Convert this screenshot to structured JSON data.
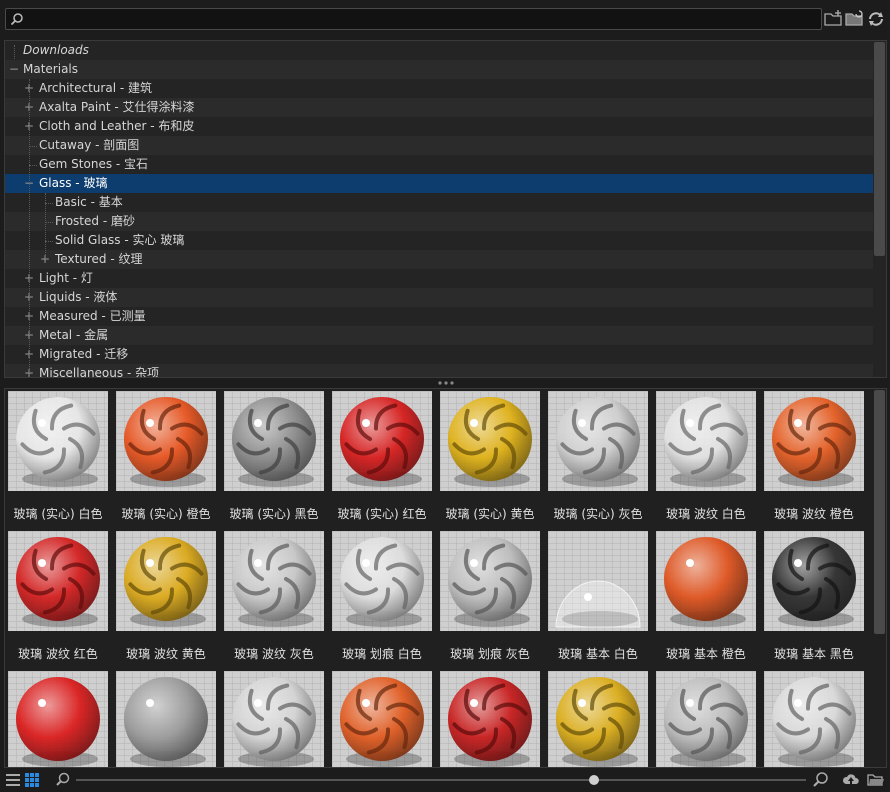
{
  "search": {
    "value": "",
    "placeholder": "",
    "icon": "search-icon"
  },
  "toolbar_top": {
    "icons": [
      "folder-add-icon",
      "folder-refresh-icon",
      "refresh-icon"
    ]
  },
  "tree": {
    "rows": [
      {
        "label": "Downloads",
        "level": 0,
        "expander": "",
        "italic": true
      },
      {
        "label": "Materials",
        "level": 0,
        "expander": "−"
      },
      {
        "label": "Architectural - 建筑",
        "level": 1,
        "expander": "+"
      },
      {
        "label": "Axalta Paint - 艾仕得涂料漆",
        "level": 1,
        "expander": "+"
      },
      {
        "label": "Cloth and Leather - 布和皮",
        "level": 1,
        "expander": "+"
      },
      {
        "label": "Cutaway - 剖面图",
        "level": 1,
        "expander": ""
      },
      {
        "label": "Gem Stones - 宝石",
        "level": 1,
        "expander": ""
      },
      {
        "label": "Glass - 玻璃",
        "level": 1,
        "expander": "−",
        "selected": true
      },
      {
        "label": "Basic - 基本",
        "level": 2,
        "expander": ""
      },
      {
        "label": "Frosted - 磨砂",
        "level": 2,
        "expander": ""
      },
      {
        "label": "Solid Glass - 实心 玻璃",
        "level": 2,
        "expander": ""
      },
      {
        "label": "Textured - 纹理",
        "level": 2,
        "expander": "+"
      },
      {
        "label": "Light - 灯",
        "level": 1,
        "expander": "+"
      },
      {
        "label": "Liquids - 液体",
        "level": 1,
        "expander": "+"
      },
      {
        "label": "Measured - 已测量",
        "level": 1,
        "expander": "+"
      },
      {
        "label": "Metal - 金属",
        "level": 1,
        "expander": "+"
      },
      {
        "label": "Migrated - 迁移",
        "level": 1,
        "expander": "+"
      },
      {
        "label": "Miscellaneous - 杂项",
        "level": 1,
        "expander": "+"
      }
    ]
  },
  "materials": [
    {
      "label": "玻璃 (实心) 白色",
      "color": "#e8e8e8",
      "style": "swirl"
    },
    {
      "label": "玻璃 (实心) 橙色",
      "color": "#e8501a",
      "style": "swirl"
    },
    {
      "label": "玻璃 (实心) 黑色",
      "color": "#8a8a8a",
      "style": "swirl"
    },
    {
      "label": "玻璃 (实心) 红色",
      "color": "#d81818",
      "style": "swirl"
    },
    {
      "label": "玻璃 (实心) 黄色",
      "color": "#e0b010",
      "style": "swirl"
    },
    {
      "label": "玻璃 (实心) 灰色",
      "color": "#cfcfcf",
      "style": "swirl"
    },
    {
      "label": "玻璃 波纹 白色",
      "color": "#e2e2e2",
      "style": "swirl"
    },
    {
      "label": "玻璃 波纹 橙色",
      "color": "#e65a1e",
      "style": "swirl"
    },
    {
      "label": "玻璃 波纹 红色",
      "color": "#d41a1a",
      "style": "swirl"
    },
    {
      "label": "玻璃 波纹 黄色",
      "color": "#dca814",
      "style": "swirl"
    },
    {
      "label": "玻璃 波纹 灰色",
      "color": "#c8c8c8",
      "style": "swirl"
    },
    {
      "label": "玻璃 划痕 白色",
      "color": "#dedede",
      "style": "swirl"
    },
    {
      "label": "玻璃 划痕 灰色",
      "color": "#bdbdbd",
      "style": "swirl"
    },
    {
      "label": "玻璃 基本 白色",
      "color": "#efefef",
      "style": "dome"
    },
    {
      "label": "玻璃 基本 橙色",
      "color": "#e0501a",
      "style": "smooth"
    },
    {
      "label": "玻璃 基本 黑色",
      "color": "#2a2a2a",
      "style": "swirl"
    },
    {
      "label": "",
      "color": "#dc1818",
      "style": "smooth"
    },
    {
      "label": "",
      "color": "#9a9a9a",
      "style": "smooth"
    },
    {
      "label": "",
      "color": "#d4d4d4",
      "style": "swirl"
    },
    {
      "label": "",
      "color": "#e2581c",
      "style": "swirl"
    },
    {
      "label": "",
      "color": "#c81818",
      "style": "swirl"
    },
    {
      "label": "",
      "color": "#dcac14",
      "style": "swirl"
    },
    {
      "label": "",
      "color": "#bcbcbc",
      "style": "swirl"
    },
    {
      "label": "",
      "color": "#dadada",
      "style": "swirl"
    }
  ],
  "bottom_bar": {
    "icons": [
      "list-view-icon",
      "grid-view-icon",
      "zoom-out-icon",
      "zoom-in-icon",
      "upload-icon",
      "folder-open-icon"
    ],
    "zoom_level": 0.71
  },
  "colors": {
    "selection": "#0d3c6e",
    "accent": "#1e7ad8"
  }
}
